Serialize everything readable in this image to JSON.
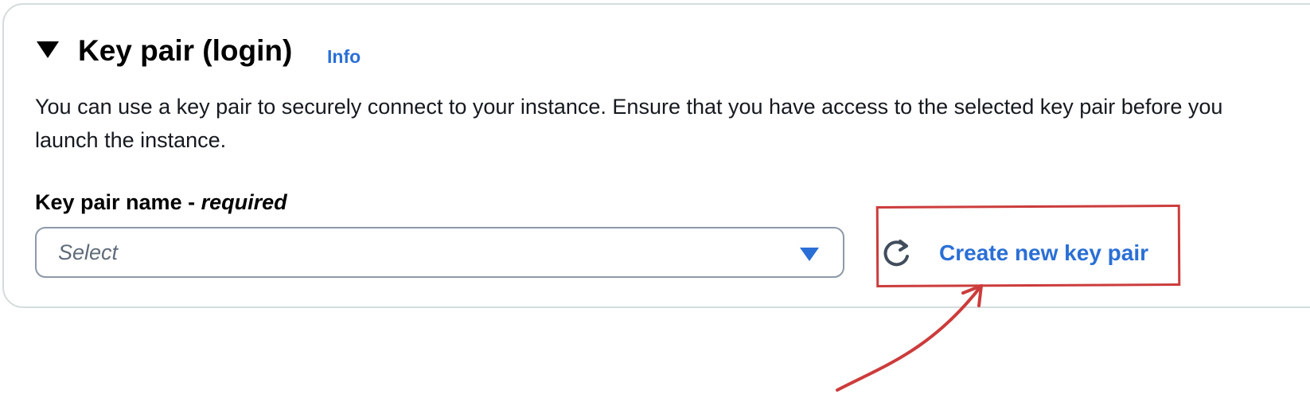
{
  "section": {
    "title": "Key pair (login)",
    "info_link": "Info",
    "description": "You can use a key pair to securely connect to your instance. Ensure that you have access to the selected key pair before you launch the instance."
  },
  "key_pair_field": {
    "label_name": "Key pair name - ",
    "label_required": "required",
    "placeholder": "Select",
    "create_link": "Create new key pair"
  },
  "icons": {
    "collapse": "caret-down-icon",
    "dropdown": "dropdown-arrow-icon",
    "refresh": "refresh-icon"
  },
  "colors": {
    "link": "#2a6fd6",
    "annotation": "#cc3c3c",
    "border": "#8d99a8"
  }
}
